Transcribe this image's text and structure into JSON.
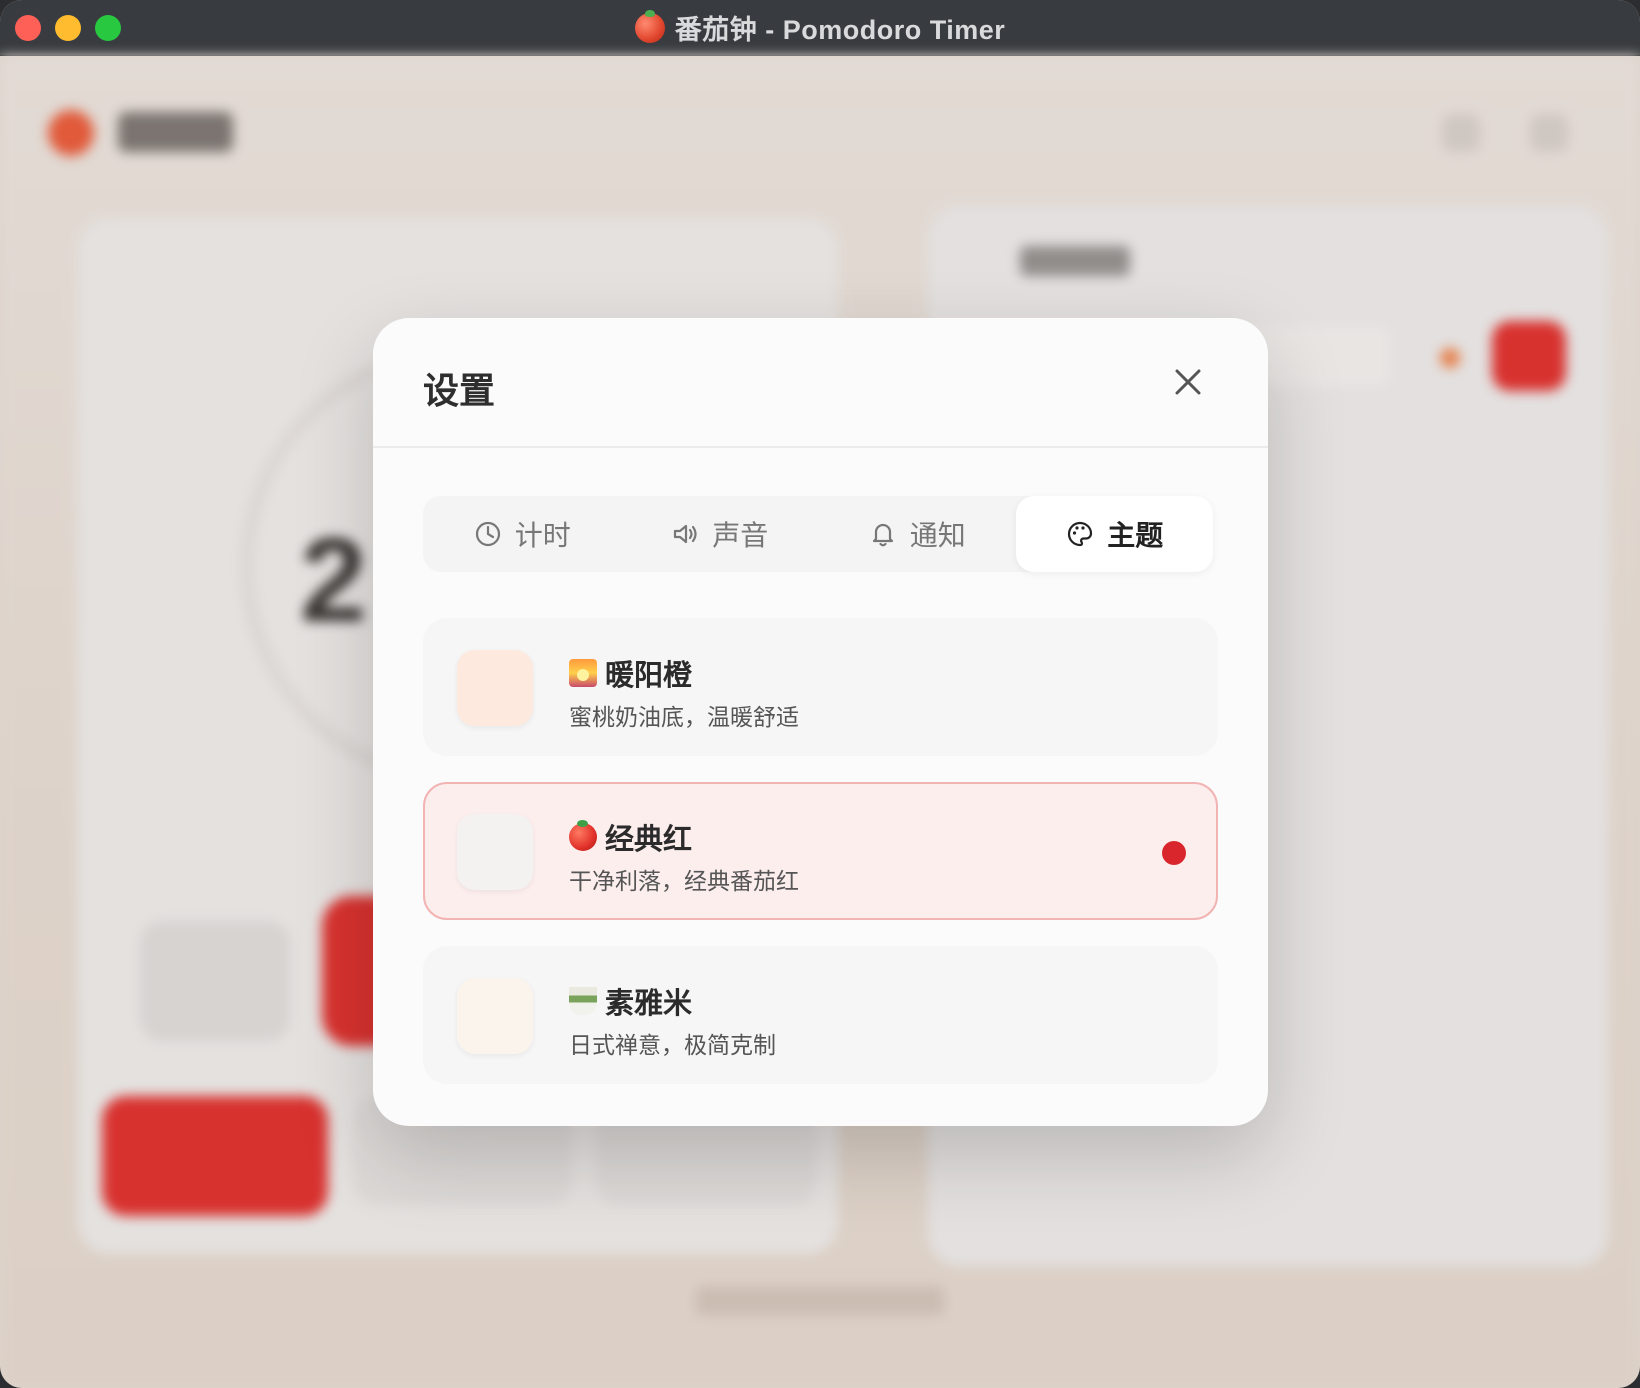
{
  "window": {
    "title": "番茄钟 - Pomodoro Timer"
  },
  "modal": {
    "title": "设置",
    "tabs": [
      {
        "label": "计时",
        "icon": "clock-icon",
        "active": false
      },
      {
        "label": "声音",
        "icon": "speaker-icon",
        "active": false
      },
      {
        "label": "通知",
        "icon": "bell-icon",
        "active": false
      },
      {
        "label": "主题",
        "icon": "palette-icon",
        "active": true
      }
    ],
    "themes": [
      {
        "name": "暖阳橙",
        "emoji": "sunrise-emoji",
        "description": "蜜桃奶油底，温暖舒适",
        "swatch_color": "#fde9dd",
        "selected": false
      },
      {
        "name": "经典红",
        "emoji": "tomato-emoji",
        "description": "干净利落，经典番茄红",
        "swatch_color": "#f4f1f1",
        "selected": true
      },
      {
        "name": "素雅米",
        "emoji": "tea-emoji",
        "description": "日式禅意，极简克制",
        "swatch_color": "#faf4ec",
        "selected": false
      }
    ]
  },
  "colors": {
    "accent": "#d9262c",
    "selected_bg": "#fdeeee",
    "selected_border": "#f2b3b3"
  }
}
